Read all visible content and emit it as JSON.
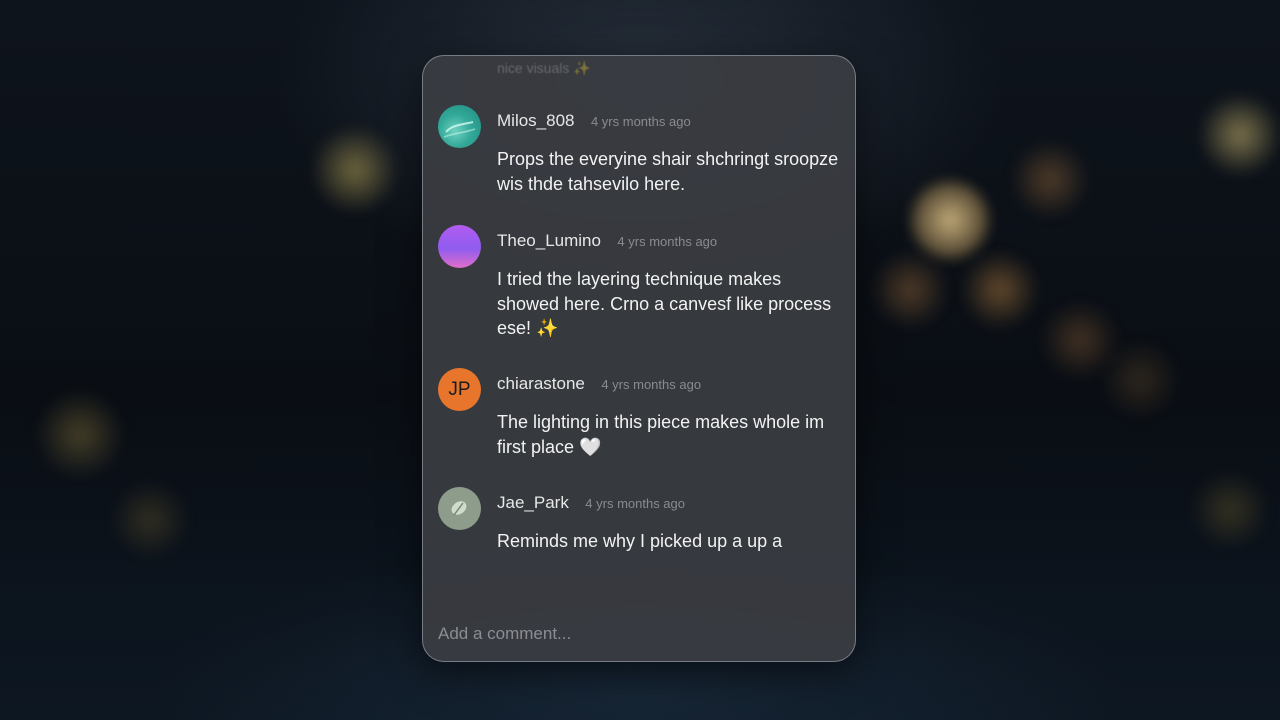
{
  "panel": {
    "header_faded": "nice visuals ✨"
  },
  "comments": [
    {
      "username": "Milos_808",
      "time": "4 yrs months ago",
      "text": "Props the everyine shair shchringt sroopze wis thde tahsevilo here.",
      "avatar": "teal-landscape-avatar"
    },
    {
      "username": "Theo_Lumino",
      "time": "4 yrs months ago",
      "text": "I tried the layering technique makes showed here. Crno a canvesf like process ese! ",
      "emoji": "✨",
      "avatar": "violet-gradient-avatar"
    },
    {
      "username": "chiarastone",
      "time": "4 yrs months ago",
      "text": "The lighting in this piece makes whole im first place ",
      "emoji": "🤍",
      "avatar_initials": "JP",
      "avatar": "initials-avatar"
    },
    {
      "username": "Jae_Park",
      "time": "4 yrs months ago",
      "text": "Reminds me why I picked up a up a",
      "avatar": "green-photo-avatar"
    }
  ],
  "input": {
    "placeholder": "Add a comment..."
  },
  "colors": {
    "panel_bg": "#3a3c42",
    "text": "#f2f2f2",
    "muted": "#8a8b90",
    "orange_avatar": "#e8752c"
  }
}
